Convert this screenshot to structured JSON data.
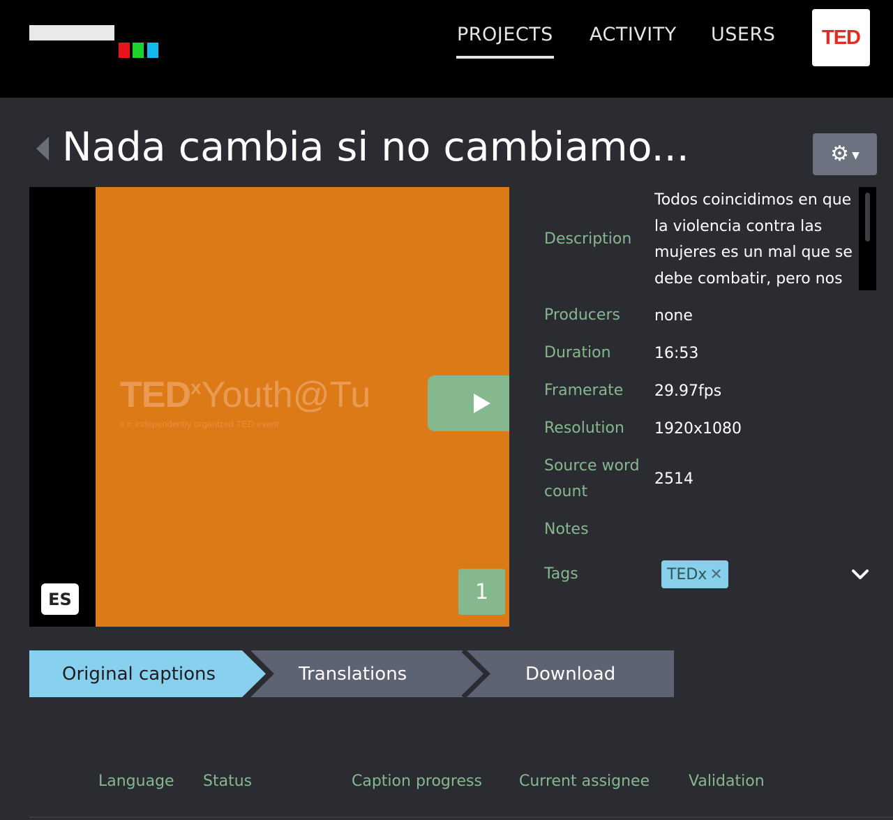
{
  "nav": {
    "items": [
      {
        "label": "PROJECTS",
        "active": true
      },
      {
        "label": "ACTIVITY"
      },
      {
        "label": "USERS"
      }
    ],
    "brand_badge": "TED",
    "logo_colors": [
      "#e8141b",
      "#1dd32b",
      "#13b8ec"
    ]
  },
  "header": {
    "title": "Nada cambia si no cambiamo...",
    "back_icon": "chevron-left-icon",
    "settings_icon": "gear-icon"
  },
  "video": {
    "overlay_brand": "TED",
    "overlay_brand_sup": "x",
    "overlay_event": "Youth@Tu",
    "overlay_sub": "x = independently organized TED event",
    "language_badge": "ES",
    "count_badge": "1",
    "frame_color": "#dc7a17"
  },
  "meta": {
    "description_label": "Description",
    "description": "Todos coincidimos en que la violencia contra las mujeres es un mal que se debe combatir, pero nos",
    "producers_label": "Producers",
    "producers": "none",
    "duration_label": "Duration",
    "duration": "16:53",
    "framerate_label": "Framerate",
    "framerate": "29.97fps",
    "resolution_label": "Resolution",
    "resolution": "1920x1080",
    "wordcount_label_1": "Source word",
    "wordcount_label_2": "count",
    "wordcount": "2514",
    "notes_label": "Notes",
    "tags_label": "Tags",
    "tags": [
      "TEDx"
    ]
  },
  "steps": [
    {
      "label": "Original captions",
      "active": true
    },
    {
      "label": "Translations"
    },
    {
      "label": "Download"
    }
  ],
  "table": {
    "columns": [
      "Language",
      "Status",
      "Caption progress",
      "Current assignee",
      "Validation"
    ]
  },
  "colors": {
    "accent_green": "#86b88f",
    "accent_blue": "#87d1ee",
    "step_inactive": "#5d6373",
    "background": "#2a2c31"
  }
}
